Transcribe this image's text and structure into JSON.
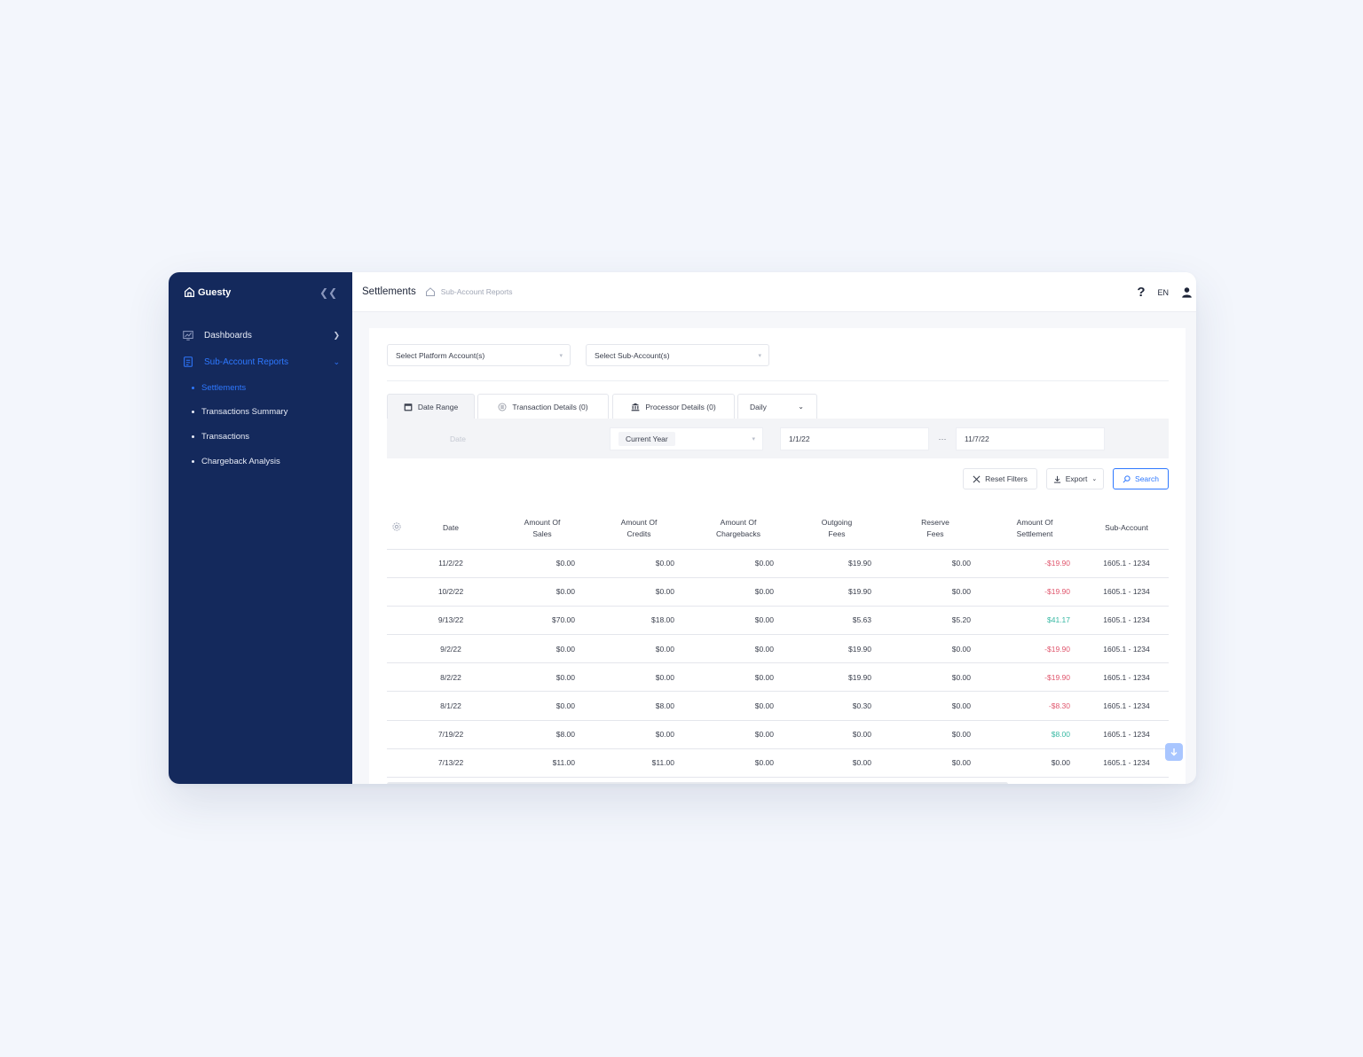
{
  "app": {
    "brand": "Guesty"
  },
  "sidebar": {
    "items": [
      {
        "label": "Dashboards",
        "icon": "chart-board-icon"
      },
      {
        "label": "Sub-Account Reports",
        "icon": "report-icon"
      }
    ],
    "sub_items": [
      {
        "label": "Settlements"
      },
      {
        "label": "Transactions Summary"
      },
      {
        "label": "Transactions"
      },
      {
        "label": "Chargeback Analysis"
      }
    ]
  },
  "header": {
    "title": "Settlements",
    "breadcrumb": "Sub-Account Reports",
    "language": "EN"
  },
  "filters": {
    "platform_placeholder": "Select Platform Account(s)",
    "subaccount_placeholder": "Select Sub-Account(s)",
    "tabs": [
      {
        "label": "Date Range"
      },
      {
        "label": "Transaction Details (0)"
      },
      {
        "label": "Processor Details (0)"
      }
    ],
    "interval": "Daily",
    "date_field": "Date",
    "period": "Current Year",
    "date_from": "1/1/22",
    "date_separator": "···",
    "date_to": "11/7/22"
  },
  "actions": {
    "reset": "Reset Filters",
    "export": "Export",
    "search": "Search"
  },
  "table": {
    "columns": [
      {
        "line1": "Date",
        "line2": ""
      },
      {
        "line1": "Amount Of",
        "line2": "Sales"
      },
      {
        "line1": "Amount Of",
        "line2": "Credits"
      },
      {
        "line1": "Amount Of",
        "line2": "Chargebacks"
      },
      {
        "line1": "Outgoing",
        "line2": "Fees"
      },
      {
        "line1": "Reserve",
        "line2": "Fees"
      },
      {
        "line1": "Amount Of",
        "line2": "Settlement"
      },
      {
        "line1": "Sub-Account",
        "line2": ""
      }
    ],
    "rows": [
      {
        "date": "11/2/22",
        "sales": "$0.00",
        "credits": "$0.00",
        "chargebacks": "$0.00",
        "outgoing": "$19.90",
        "reserve": "$0.00",
        "settlement": "-$19.90",
        "status": "neg",
        "sub": "1605.1 - 1234"
      },
      {
        "date": "10/2/22",
        "sales": "$0.00",
        "credits": "$0.00",
        "chargebacks": "$0.00",
        "outgoing": "$19.90",
        "reserve": "$0.00",
        "settlement": "-$19.90",
        "status": "neg",
        "sub": "1605.1 - 1234"
      },
      {
        "date": "9/13/22",
        "sales": "$70.00",
        "credits": "$18.00",
        "chargebacks": "$0.00",
        "outgoing": "$5.63",
        "reserve": "$5.20",
        "settlement": "$41.17",
        "status": "pos",
        "sub": "1605.1 - 1234"
      },
      {
        "date": "9/2/22",
        "sales": "$0.00",
        "credits": "$0.00",
        "chargebacks": "$0.00",
        "outgoing": "$19.90",
        "reserve": "$0.00",
        "settlement": "-$19.90",
        "status": "neg",
        "sub": "1605.1 - 1234"
      },
      {
        "date": "8/2/22",
        "sales": "$0.00",
        "credits": "$0.00",
        "chargebacks": "$0.00",
        "outgoing": "$19.90",
        "reserve": "$0.00",
        "settlement": "-$19.90",
        "status": "neg",
        "sub": "1605.1 - 1234"
      },
      {
        "date": "8/1/22",
        "sales": "$0.00",
        "credits": "$8.00",
        "chargebacks": "$0.00",
        "outgoing": "$0.30",
        "reserve": "$0.00",
        "settlement": "-$8.30",
        "status": "neg",
        "sub": "1605.1 - 1234"
      },
      {
        "date": "7/19/22",
        "sales": "$8.00",
        "credits": "$0.00",
        "chargebacks": "$0.00",
        "outgoing": "$0.00",
        "reserve": "$0.00",
        "settlement": "$8.00",
        "status": "pos",
        "sub": "1605.1 - 1234"
      },
      {
        "date": "7/13/22",
        "sales": "$11.00",
        "credits": "$11.00",
        "chargebacks": "$0.00",
        "outgoing": "$0.00",
        "reserve": "$0.00",
        "settlement": "$0.00",
        "status": "",
        "sub": "1605.1 - 1234"
      }
    ]
  },
  "colors": {
    "sidebar_bg": "#14295c",
    "accent": "#2e78ff",
    "negative": "#e0566d",
    "positive": "#37b8a3"
  }
}
